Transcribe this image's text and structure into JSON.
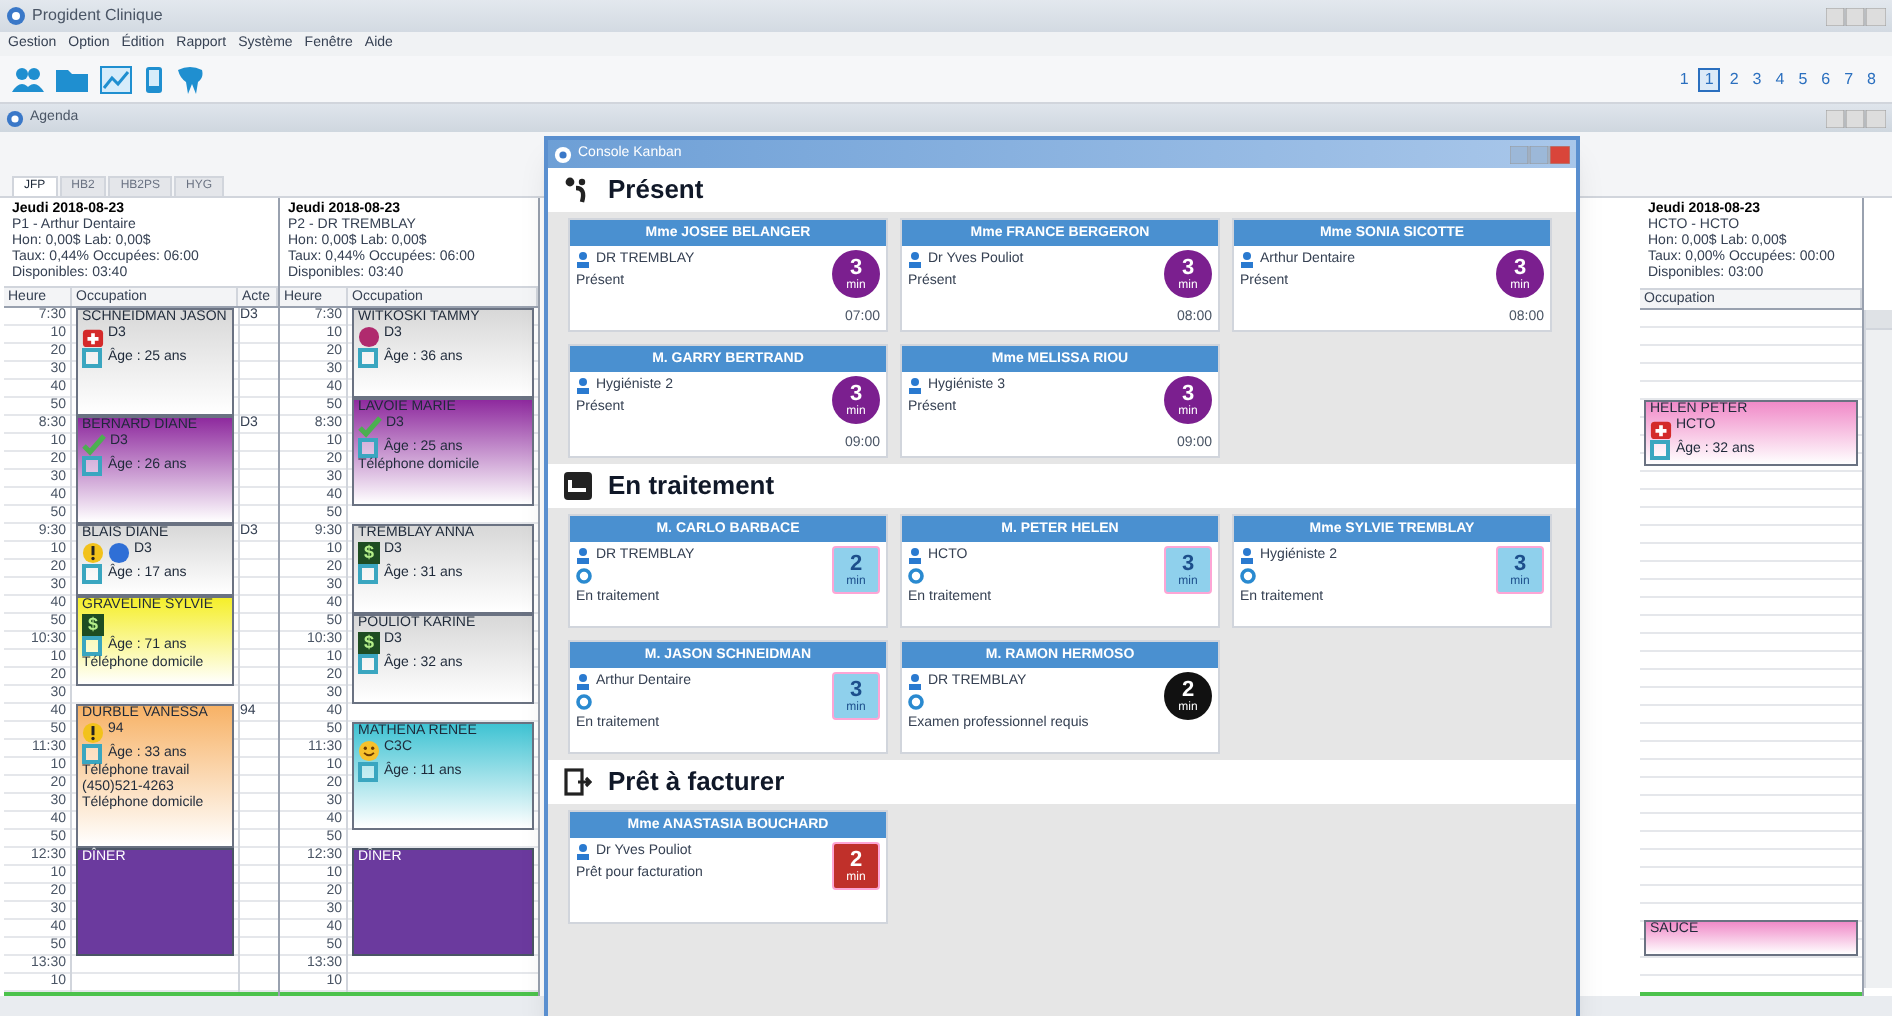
{
  "app": {
    "title": "Progident Clinique",
    "menu": [
      "Gestion",
      "Option",
      "Édition",
      "Rapport",
      "Système",
      "Fenêtre",
      "Aide"
    ],
    "pages": [
      {
        "label": "1",
        "selected": false
      },
      {
        "label": "1",
        "selected": true
      },
      {
        "label": "2",
        "selected": false
      },
      {
        "label": "3",
        "selected": false
      },
      {
        "label": "4",
        "selected": false
      },
      {
        "label": "5",
        "selected": false
      },
      {
        "label": "6",
        "selected": false
      },
      {
        "label": "7",
        "selected": false
      },
      {
        "label": "8",
        "selected": false
      }
    ]
  },
  "agenda": {
    "title": "Agenda",
    "tabs": [
      {
        "label": "JFP",
        "selected": true
      },
      {
        "label": "HB2",
        "selected": false
      },
      {
        "label": "HB2PS",
        "selected": false
      },
      {
        "label": "HYG",
        "selected": false
      }
    ],
    "columns": [
      {
        "date": "Jeudi 2018-08-23",
        "provider": "P1 - Arthur Dentaire",
        "info": [
          "Hon: 0,00$ Lab: 0,00$",
          "Taux: 0,44% Occupées: 06:00",
          "Disponibles: 03:40"
        ],
        "headers": [
          "Heure",
          "Occupation",
          "Acte"
        ],
        "blocks": [
          {
            "kind": "visit",
            "times": [
              "7:30",
              "10",
              "20",
              "30",
              "40",
              "50"
            ],
            "name": "SCHNEIDMAN JASON",
            "code": "D3",
            "acte": "D3",
            "color": "#d8d8d8",
            "icons": [
              {
                "kind": "medkit"
              }
            ],
            "age": "Âge : 25 ans"
          },
          {
            "kind": "visit",
            "times": [
              "8:30",
              "10",
              "20",
              "30",
              "40",
              "50"
            ],
            "name": "BERNARD DIANE",
            "code": "D3",
            "acte": "D3",
            "color": "#8e2a9e",
            "icons": [
              {
                "kind": "check"
              }
            ],
            "age": "Âge : 26 ans"
          },
          {
            "kind": "visit",
            "times": [
              "9:30",
              "10",
              "20",
              "30"
            ],
            "name": "BLAIS DIANE",
            "code": "D3",
            "acte": "D3",
            "color": "#d8d8d8",
            "icons": [
              {
                "kind": "warning"
              },
              {
                "kind": "dot",
                "color": "#2f6fd6"
              }
            ],
            "age": "Âge : 17 ans"
          },
          {
            "kind": "visit",
            "times": [
              "40",
              "50",
              "10:30",
              "10",
              "20"
            ],
            "name": "GRAVELINE SYLVIE",
            "color": "#f5ef2a",
            "icons": [
              {
                "kind": "money",
                "glyph": "$"
              }
            ],
            "age": "Âge : 71 ans",
            "lines": [
              "Téléphone domicile"
            ]
          },
          {
            "kind": "free",
            "times": [
              "30"
            ]
          },
          {
            "kind": "visit",
            "times": [
              "40",
              "50",
              "11:30",
              "10",
              "20",
              "30",
              "40",
              "50"
            ],
            "name": "DURBLE VANESSA",
            "code": "94",
            "acte": "94",
            "color": "#f7b266",
            "icons": [
              {
                "kind": "warning"
              }
            ],
            "age": "Âge : 33 ans",
            "lines": [
              "Téléphone travail",
              "(450)521-4263",
              "Téléphone domicile"
            ]
          },
          {
            "kind": "break",
            "times": [
              "12:30",
              "10",
              "20",
              "30",
              "40",
              "50"
            ],
            "name": "DÎNER",
            "color": "#6b3a9e"
          },
          {
            "kind": "free",
            "times": [
              "13:30"
            ]
          },
          {
            "kind": "free",
            "times": [
              "10"
            ]
          }
        ]
      },
      {
        "date": "Jeudi 2018-08-23",
        "provider": "P2 - DR TREMBLAY",
        "info": [
          "Hon: 0,00$ Lab: 0,00$",
          "Taux: 0,44% Occupées: 06:00",
          "Disponibles: 03:40"
        ],
        "headers": [
          "Heure",
          "Occupation"
        ],
        "blocks": [
          {
            "kind": "visit",
            "times": [
              "7:30",
              "10",
              "20",
              "30",
              "40"
            ],
            "name": "WITKOSKI TAMMY",
            "code": "D3",
            "color": "#d8d8d8",
            "icons": [
              {
                "kind": "dot",
                "color": "#b02a6e"
              }
            ],
            "age": "Âge : 36 ans"
          },
          {
            "kind": "visit",
            "times": [
              "50",
              "8:30",
              "10",
              "20",
              "30",
              "40"
            ],
            "name": "LAVOIE MARIE",
            "code": "D3",
            "color": "#8e2a9e",
            "icons": [
              {
                "kind": "check"
              }
            ],
            "age": "Âge : 25 ans",
            "lines": [
              "Téléphone domicile"
            ]
          },
          {
            "kind": "free",
            "times": [
              "50"
            ]
          },
          {
            "kind": "visit",
            "times": [
              "9:30",
              "10",
              "20",
              "30",
              "40"
            ],
            "name": "TREMBLAY ANNA",
            "code": "D3",
            "color": "#d8d8d8",
            "icons": [
              {
                "kind": "money",
                "glyph": "$"
              }
            ],
            "age": "Âge : 31 ans"
          },
          {
            "kind": "visit",
            "times": [
              "50",
              "10:30",
              "10",
              "20",
              "30"
            ],
            "name": "POULIOT KARINE",
            "code": "D3",
            "color": "#d8d8d8",
            "icons": [
              {
                "kind": "money",
                "glyph": "$"
              }
            ],
            "age": "Âge : 32 ans"
          },
          {
            "kind": "free",
            "times": [
              "40"
            ]
          },
          {
            "kind": "visit",
            "times": [
              "50",
              "11:30",
              "10",
              "20",
              "30",
              "40"
            ],
            "name": "MATHENA RENEE",
            "code": "C3C",
            "color": "#3fc3d3",
            "icons": [
              {
                "kind": "smiley"
              }
            ],
            "age": "Âge : 11 ans"
          },
          {
            "kind": "free",
            "times": [
              "50"
            ]
          },
          {
            "kind": "break",
            "times": [
              "12:30",
              "10",
              "20",
              "30",
              "40",
              "50"
            ],
            "name": "DÎNER",
            "color": "#6b3a9e"
          },
          {
            "kind": "free",
            "times": [
              "13:30"
            ]
          },
          {
            "kind": "free",
            "times": [
              "10"
            ]
          }
        ]
      },
      {
        "date": "Jeudi 2018-08-23",
        "provider": "HCTO - HCTO",
        "info": [
          "Hon: 0,00$ Lab: 0,00$",
          "Taux: 0,00% Occupées: 00:00",
          "Disponibles: 03:00"
        ],
        "headers": [
          "Occupation"
        ],
        "blocks": [
          {
            "kind": "free"
          },
          {
            "kind": "free"
          },
          {
            "kind": "free"
          },
          {
            "kind": "free"
          },
          {
            "kind": "free"
          },
          {
            "kind": "visit",
            "name": "HELEN PETER",
            "code": "HCTO",
            "color": "#f08ac8",
            "icons": [
              {
                "kind": "medkit"
              }
            ],
            "age": "Âge : 32 ans"
          },
          {
            "kind": "gap"
          },
          {
            "kind": "visit",
            "name": "SAUCE",
            "color": "#f08ac8"
          },
          {
            "kind": "free"
          },
          {
            "kind": "free"
          }
        ]
      }
    ]
  },
  "kanban": {
    "title": "Console Kanban",
    "sections": [
      {
        "kind": "present",
        "title": "Présent",
        "cards": [
          {
            "name": "Mme JOSEE BELANGER",
            "doctor": "DR TREMBLAY",
            "status": "Présent",
            "badge": {
              "kind": "circle",
              "color": "#7b1f8f",
              "value": "3",
              "unit": "min"
            },
            "time": "07:00"
          },
          {
            "name": "Mme FRANCE BERGERON",
            "doctor": "Dr Yves Pouliot",
            "status": "Présent",
            "badge": {
              "kind": "circle",
              "color": "#7b1f8f",
              "value": "3",
              "unit": "min"
            },
            "time": "08:00"
          },
          {
            "name": "Mme SONIA SICOTTE",
            "doctor": "Arthur Dentaire",
            "status": "Présent",
            "badge": {
              "kind": "circle",
              "color": "#7b1f8f",
              "value": "3",
              "unit": "min"
            },
            "time": "08:00"
          },
          {
            "name": "M. GARRY BERTRAND",
            "doctor": "Hygiéniste 2",
            "status": "Présent",
            "badge": {
              "kind": "circle",
              "color": "#7b1f8f",
              "value": "3",
              "unit": "min"
            },
            "time": "09:00"
          },
          {
            "name": "Mme MELISSA RIOU",
            "doctor": "Hygiéniste 3",
            "status": "Présent",
            "badge": {
              "kind": "circle",
              "color": "#7b1f8f",
              "value": "3",
              "unit": "min"
            },
            "time": "09:00"
          }
        ]
      },
      {
        "kind": "treatment",
        "title": "En traitement",
        "cards": [
          {
            "name": "M. CARLO BARBACE",
            "doctor": "DR TREMBLAY",
            "status": "En traitement",
            "badge": {
              "kind": "square",
              "color": "#8fd0ec",
              "value": "2",
              "unit": "min"
            }
          },
          {
            "name": "M. PETER HELEN",
            "doctor": "HCTO",
            "status": "En traitement",
            "badge": {
              "kind": "square",
              "color": "#8fd0ec",
              "value": "3",
              "unit": "min"
            }
          },
          {
            "name": "Mme SYLVIE TREMBLAY",
            "doctor": "Hygiéniste 2",
            "status": "En traitement",
            "badge": {
              "kind": "square",
              "color": "#8fd0ec",
              "value": "3",
              "unit": "min"
            }
          },
          {
            "name": "M. JASON SCHNEIDMAN",
            "doctor": "Arthur Dentaire",
            "status": "En traitement",
            "badge": {
              "kind": "square",
              "color": "#8fd0ec",
              "value": "3",
              "unit": "min"
            }
          },
          {
            "name": "M. RAMON HERMOSO",
            "doctor": "DR TREMBLAY",
            "status": "Examen professionnel requis",
            "badge": {
              "kind": "circle",
              "color": "#111111",
              "value": "2",
              "unit": "min"
            }
          }
        ]
      },
      {
        "kind": "billing",
        "title": "Prêt à facturer",
        "cards": [
          {
            "name": "Mme ANASTASIA BOUCHARD",
            "doctor": "Dr Yves Pouliot",
            "status": "Prêt pour facturation",
            "badge": {
              "kind": "square",
              "color": "#c0302a",
              "value": "2",
              "unit": "min"
            }
          }
        ]
      }
    ]
  }
}
